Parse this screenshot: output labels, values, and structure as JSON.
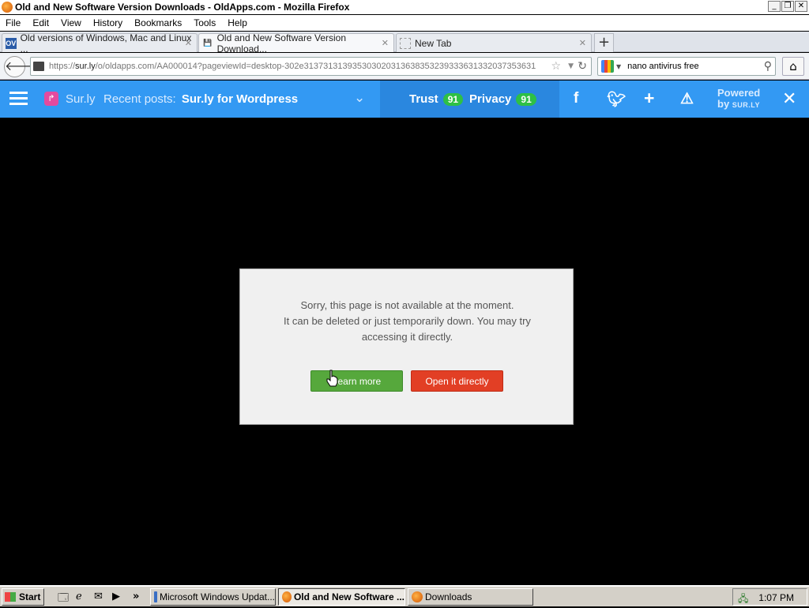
{
  "window": {
    "title": "Old and New Software Version Downloads - OldApps.com - Mozilla Firefox"
  },
  "menu": [
    "File",
    "Edit",
    "View",
    "History",
    "Bookmarks",
    "Tools",
    "Help"
  ],
  "tabs": [
    {
      "icon": "OV",
      "label": "Old versions of Windows, Mac and Linux ..."
    },
    {
      "icon": "💾",
      "label": "Old and New Software Version Download..."
    },
    {
      "icon": "",
      "label": "New Tab"
    }
  ],
  "navbar": {
    "url_prefix": "https://",
    "url_host": "sur.ly",
    "url_rest": "/o/oldapps.com/AA000014?pageviewId=desktop-302e313731313935303020313638353239333631332037353631",
    "search_value": "nano antivirus free"
  },
  "surly": {
    "brand": "Sur.ly",
    "recent_label": "Recent posts:",
    "recent_post": "Sur.ly for Wordpress",
    "trust_label": "Trust",
    "trust_value": "91",
    "privacy_label": "Privacy",
    "privacy_value": "91",
    "powered_line1": "Powered",
    "powered_line2": "by",
    "powered_brand": "SUR.LY"
  },
  "dialog": {
    "line1": "Sorry, this page is not available at the moment.",
    "line2": "It can be deleted or just temporarily down. You may try",
    "line3": "accessing it directly.",
    "learn_more": "Learn more",
    "open_directly": "Open it directly"
  },
  "taskbar": {
    "start": "Start",
    "tasks": [
      {
        "label": "Microsoft Windows Updat..."
      },
      {
        "label": "Old and New Software ..."
      },
      {
        "label": "Downloads"
      }
    ],
    "clock": "1:07 PM"
  },
  "colors": {
    "surly_bar": "#3399f3",
    "learn_button": "#56a83c",
    "open_button": "#e23f25",
    "badge_green": "#2ec045"
  }
}
